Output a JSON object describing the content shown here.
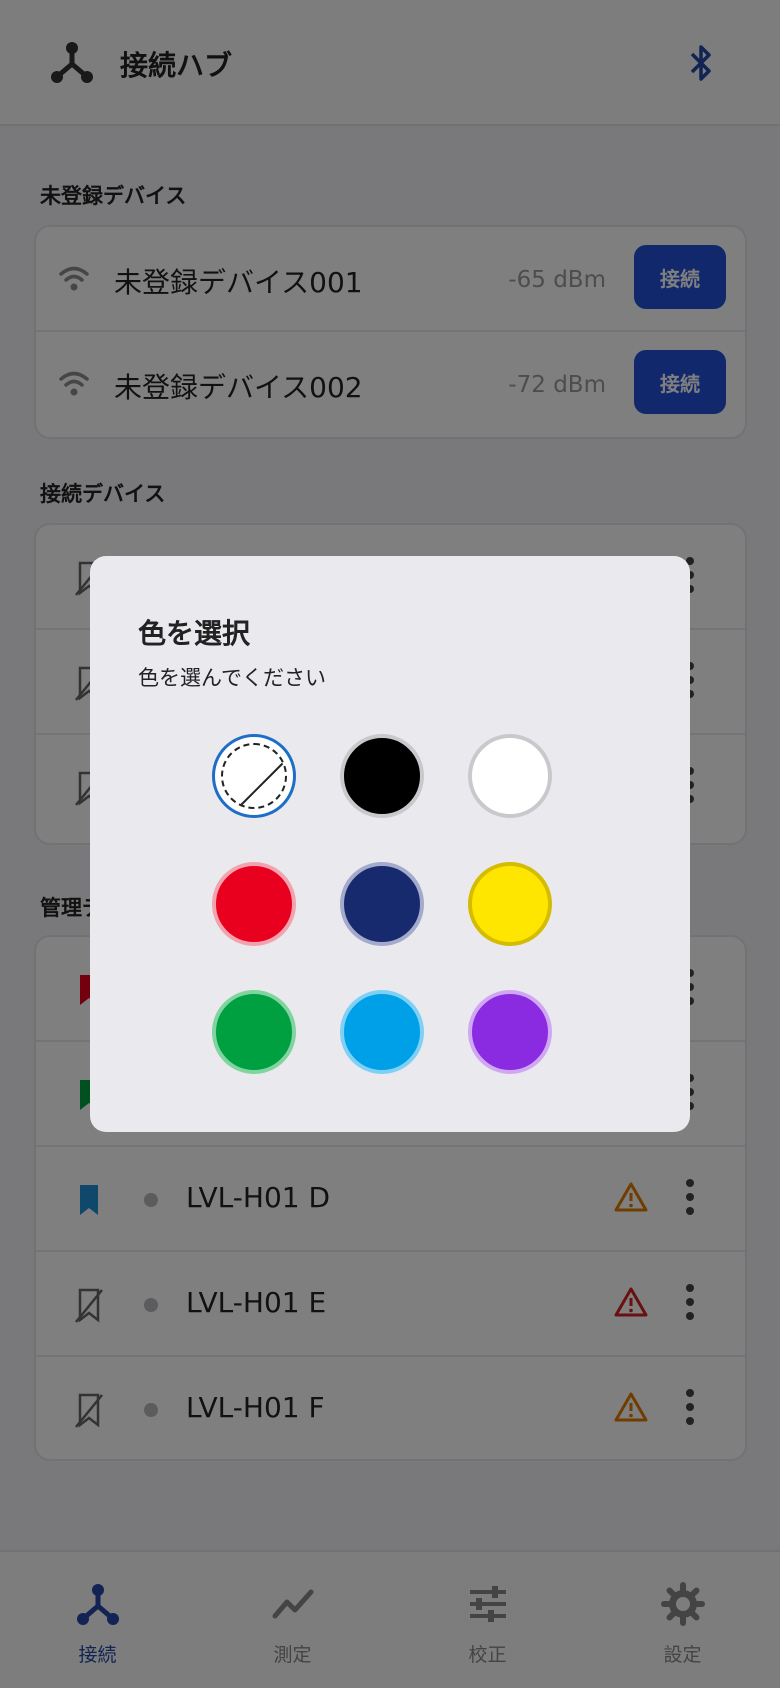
{
  "header": {
    "title": "接続ハブ",
    "hub_icon": "hub-icon",
    "bluetooth_icon": "bluetooth-icon",
    "accent_color": "#2447a8"
  },
  "unregistered": {
    "title": "未登録デバイス",
    "devices": [
      {
        "name": "未登録デバイス001",
        "rssi": "-65 dBm",
        "button": "接続"
      },
      {
        "name": "未登録デバイス002",
        "rssi": "-72 dBm",
        "button": "接続"
      }
    ]
  },
  "connected": {
    "title": "接続デバイス"
  },
  "managed": {
    "title": "管理デ",
    "devices": [
      {
        "name": "LVL-H01 D",
        "tag": "blue",
        "warning": "orange"
      },
      {
        "name": "LVL-H01 E",
        "tag": "none",
        "warning": "red"
      },
      {
        "name": "LVL-H01 F",
        "tag": "none",
        "warning": "orange"
      }
    ]
  },
  "bottom_nav": [
    {
      "label": "接続",
      "icon": "hub-icon",
      "active": true
    },
    {
      "label": "測定",
      "icon": "chart-line-icon",
      "active": false
    },
    {
      "label": "校正",
      "icon": "sliders-icon",
      "active": false
    },
    {
      "label": "設定",
      "icon": "gear-icon",
      "active": false
    }
  ],
  "dialog": {
    "title": "色を選択",
    "subtitle": "色を選んでください",
    "colors": [
      {
        "name": "none",
        "fill": null,
        "selected": true
      },
      {
        "name": "black",
        "fill": "#000000"
      },
      {
        "name": "white",
        "fill": "#ffffff"
      },
      {
        "name": "red",
        "fill": "#e8001e"
      },
      {
        "name": "navy",
        "fill": "#172a6e"
      },
      {
        "name": "yellow",
        "fill": "#ffe600"
      },
      {
        "name": "green",
        "fill": "#00a040"
      },
      {
        "name": "sky-blue",
        "fill": "#00a0e9"
      },
      {
        "name": "purple",
        "fill": "#8a2be2"
      }
    ]
  }
}
